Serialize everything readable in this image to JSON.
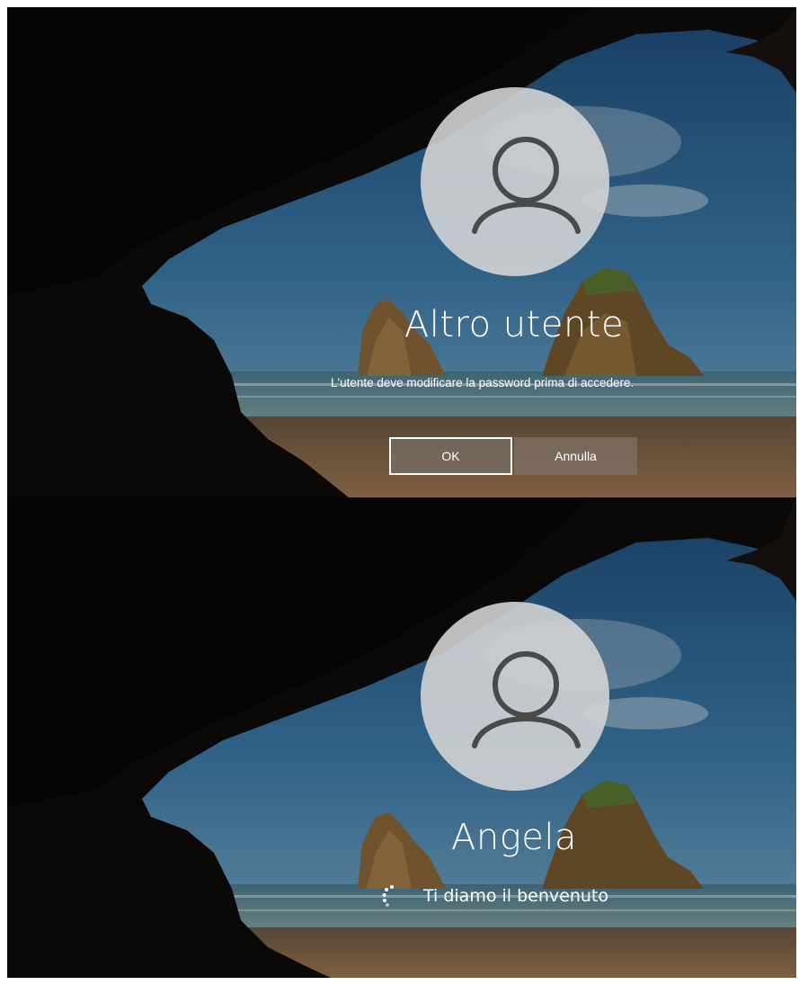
{
  "screens": [
    {
      "user_name": "Altro utente",
      "message": "L'utente deve modificare la password prima di accedere.",
      "buttons": {
        "ok": "OK",
        "cancel": "Annulla"
      },
      "avatar_icon": "user-silhouette-icon"
    },
    {
      "user_name": "Angela",
      "status": "Ti diamo il benvenuto",
      "avatar_icon": "user-silhouette-icon",
      "spinner_icon": "loading-spinner-icon"
    }
  ],
  "colors": {
    "text": "#ffffff",
    "avatar_bg": "#d6d6d6",
    "avatar_line": "#4a4a4a",
    "sky": "#2f6c9e",
    "sand": "#8a6a4a",
    "cave": "#0d0b0a"
  }
}
